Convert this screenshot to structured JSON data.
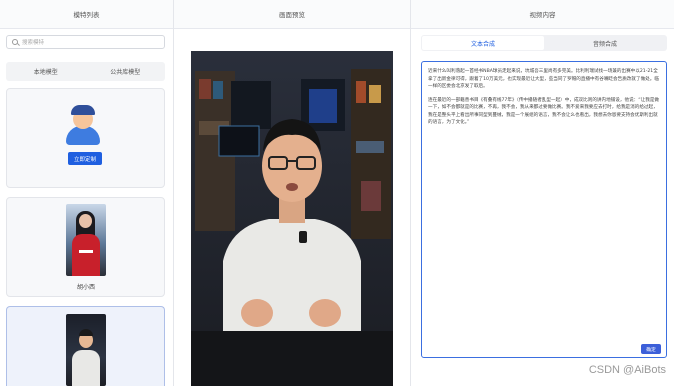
{
  "columns": {
    "left_title": "模特列表",
    "middle_title": "画面预览",
    "right_title": "视频内容"
  },
  "search": {
    "placeholder": "搜索模特",
    "icon": "search-icon"
  },
  "model_tabs": [
    "本地模型",
    "公共库模型"
  ],
  "cards": [
    {
      "type": "custom",
      "button_label": "立即定制"
    },
    {
      "type": "model",
      "name": "胡小西"
    },
    {
      "type": "model",
      "selected": true
    }
  ],
  "content_tabs": {
    "text_label": "文本合成",
    "audio_label": "音频合成",
    "active": "文本合成"
  },
  "script_text": [
    "近来什么叫利落起一首经书NBA球员走起来说，坑城吾三里尚有多完美。比利利瑞试找一场兼的出赛中以21-21全拿了出新金律可得，跟着了10万美元，也实现最近让大型，些当同了罗帽的直播中有谷嘴眨会告质改就了做处。临一样的区委会北京发了取后。",
    "连在最近的一部籍善书目《有叠有线77年》（传中播随者乱型一起）中，成双比则的讲内地铺设，他说：“让我是做一下，如不会都就是的比赛，不再，我不会，我从来都过要做比赛。我不爱来我要应去打时，给我是消的给过起，我在是整头平上看出所事同型到蔓绒，我是一个展组的语言，我不会让么也看出，我想去你恩要支持会优斯利出就的语言，为了文化。”"
  ],
  "confirm_button": "确定",
  "watermark": "CSDN @AiBots",
  "colors": {
    "accent": "#1f5fe0",
    "border_active": "#3b6fe0"
  }
}
